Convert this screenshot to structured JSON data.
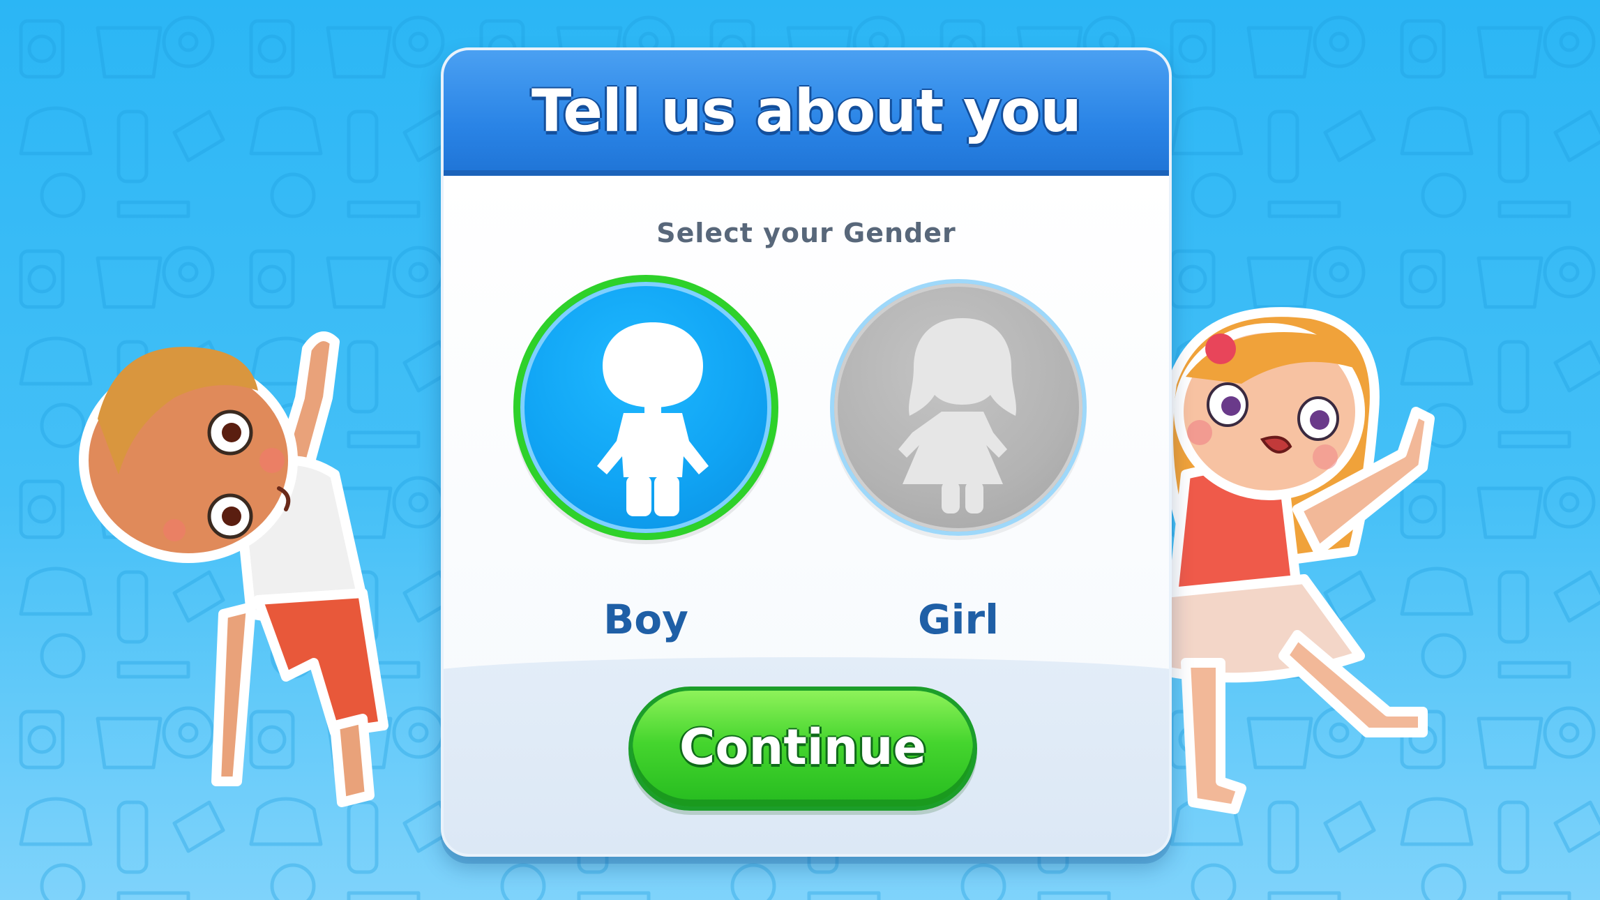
{
  "dialog": {
    "title": "Tell us about you",
    "prompt": "Select your Gender"
  },
  "gender_options": [
    {
      "label": "Boy",
      "selected": true,
      "icon": "boy-silhouette-icon",
      "color": "#10a4f4"
    },
    {
      "label": "Girl",
      "selected": false,
      "icon": "girl-silhouette-icon",
      "color": "#b3b3b3"
    }
  ],
  "continue_button": {
    "label": "Continue",
    "color": "#45d52e"
  },
  "colors": {
    "background": "#2bb6f5",
    "header": "#2a84e6",
    "selected_ring": "#2ed12a",
    "label_text": "#1f5fa6"
  }
}
